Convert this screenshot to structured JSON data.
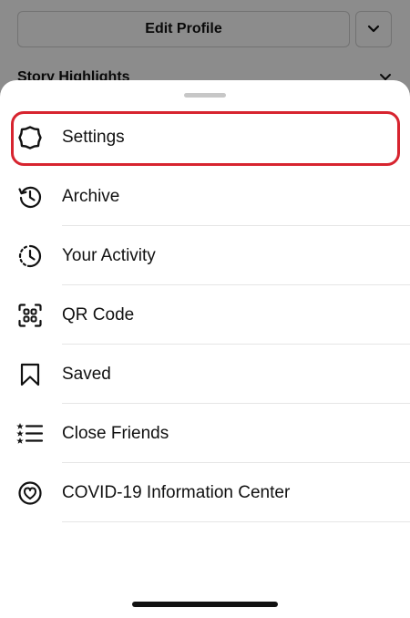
{
  "profile": {
    "edit_profile_label": "Edit Profile",
    "story_highlights_label": "Story Highlights"
  },
  "sheet": {
    "items": [
      {
        "label": "Settings",
        "icon": "gear-icon",
        "highlighted": true
      },
      {
        "label": "Archive",
        "icon": "archive-clock-icon"
      },
      {
        "label": "Your Activity",
        "icon": "activity-clock-icon"
      },
      {
        "label": "QR Code",
        "icon": "qr-code-icon"
      },
      {
        "label": "Saved",
        "icon": "bookmark-icon"
      },
      {
        "label": "Close Friends",
        "icon": "close-friends-list-icon"
      },
      {
        "label": "COVID-19 Information Center",
        "icon": "covid-info-icon"
      }
    ]
  },
  "colors": {
    "highlight_ring": "#d7242f",
    "overlay": "rgba(0,0,0,0.45)",
    "text": "#111111"
  }
}
